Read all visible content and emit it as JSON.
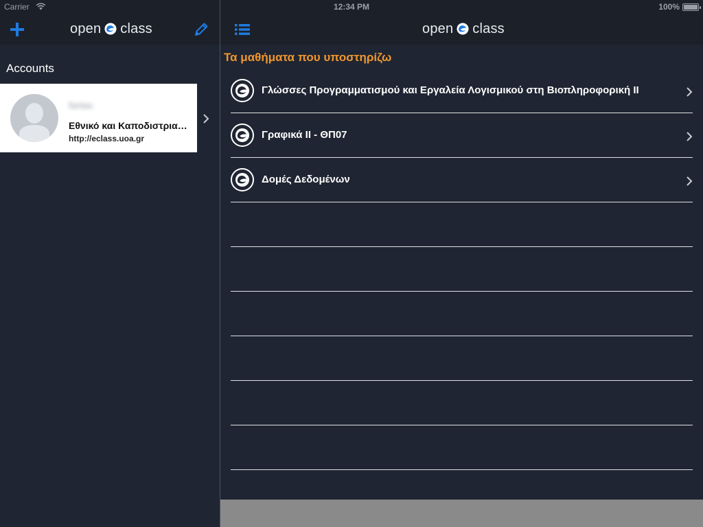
{
  "status_bar": {
    "carrier": "Carrier",
    "time": "12:34 PM",
    "battery": "100%"
  },
  "master": {
    "logo_left": "open",
    "logo_right": "class",
    "add_icon": "plus-icon",
    "edit_icon": "pencil-icon",
    "accounts_heading": "Accounts",
    "account": {
      "username": "fantas",
      "institution": "Εθνικό και Καποδιστριακό Πανεπιστήμιο Αθηνών",
      "url": "http://eclass.uoa.gr"
    }
  },
  "detail": {
    "logo_left": "open",
    "logo_right": "class",
    "menu_icon": "list-icon",
    "section_title": "Τα μαθήματα που υποστηρίζω",
    "courses": [
      {
        "title": "Γλώσσες Προγραμματισμού και Εργαλεία Λογισμικού στη Βιοπληροφορική ΙΙ"
      },
      {
        "title": "Γραφικά ΙΙ - ΘΠ07"
      },
      {
        "title": "Δομές Δεδομένων"
      }
    ]
  },
  "colors": {
    "accent_blue": "#1e7be0",
    "section_orange": "#f0962e",
    "background": "#1f2532",
    "navbar": "#1c2029"
  }
}
